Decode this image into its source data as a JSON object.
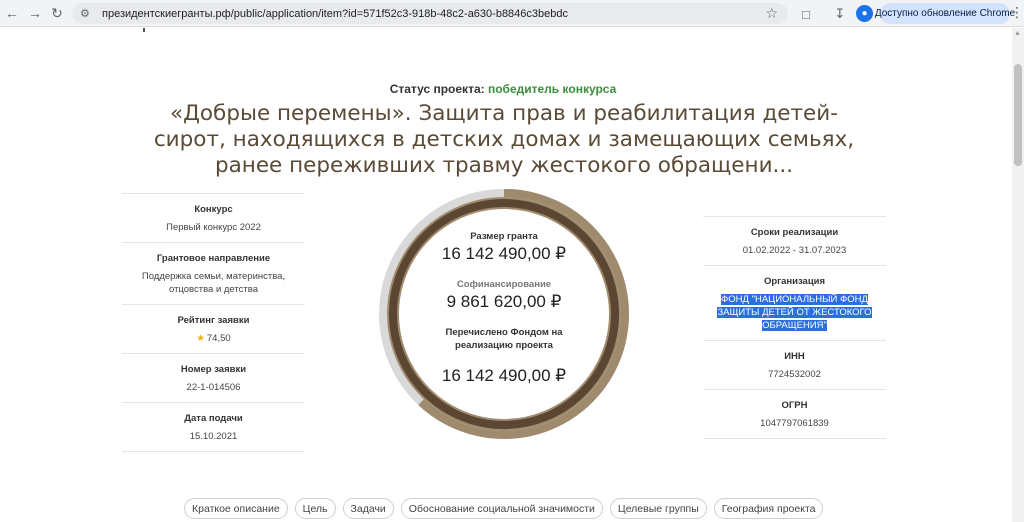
{
  "browser": {
    "url": "президентскиегранты.рф/public/application/item?id=571f52c3-918b-48c2-a630-b8846c3bebdc",
    "update_label": "Доступно обновление Chrome",
    "icons": [
      "back-icon",
      "forward-icon",
      "reload-icon",
      "site-info-icon",
      "bookmark-star-icon",
      "extensions-icon",
      "download-icon",
      "profile-icon",
      "menu-icon"
    ]
  },
  "status": {
    "label": "Статус проекта:",
    "value": "победитель конкурса"
  },
  "title": "«Добрые перемены». Защита прав и реабилитация детей-сирот, находящихся в детских домах и замещающих семьях, ранее переживших травму жестокого обращени...",
  "left_info": [
    {
      "label": "Конкурс",
      "value": "Первый конкурс 2022"
    },
    {
      "label": "Грантовое направление",
      "value": "Поддержка семьи, материнства, отцовства и детства"
    },
    {
      "label": "Рейтинг заявки",
      "value": "74,50"
    },
    {
      "label": "Номер заявки",
      "value": "22-1-014506"
    },
    {
      "label": "Дата подачи",
      "value": "15.10.2021"
    }
  ],
  "right_info": [
    {
      "label": "Сроки реализации",
      "value": "01.02.2022 - 31.07.2023"
    },
    {
      "label": "Организация",
      "value": "ФОНД \"НАЦИОНАЛЬНЫЙ ФОНД ЗАЩИТЫ ДЕТЕЙ ОТ ЖЕСТОКОГО ОБРАЩЕНИЯ\""
    },
    {
      "label": "ИНН",
      "value": "7724532002"
    },
    {
      "label": "ОГРН",
      "value": "1047797061839"
    }
  ],
  "finance": {
    "grant_label": "Размер гранта",
    "grant_value": "16 142 490,00 ₽",
    "cofinancing_label": "Софинансирование",
    "cofinancing_value": "9 861 620,00 ₽",
    "transferred_label": "Перечислено Фондом на реализацию проекта",
    "transferred_value": "16 142 490,00 ₽",
    "outer_ring_fraction": 0.62,
    "inner_ring_fraction": 1.0
  },
  "colors": {
    "status_green": "#3b8e3b",
    "title_brown": "#5a4a36",
    "ring_outer": "#a08a6e",
    "ring_inner": "#5a4632",
    "ring_track": "#d9d9d9",
    "highlight": "#2b6ee0"
  },
  "tabs": [
    "Краткое описание",
    "Цель",
    "Задачи",
    "Обоснование социальной значимости",
    "Целевые группы",
    "География проекта"
  ]
}
